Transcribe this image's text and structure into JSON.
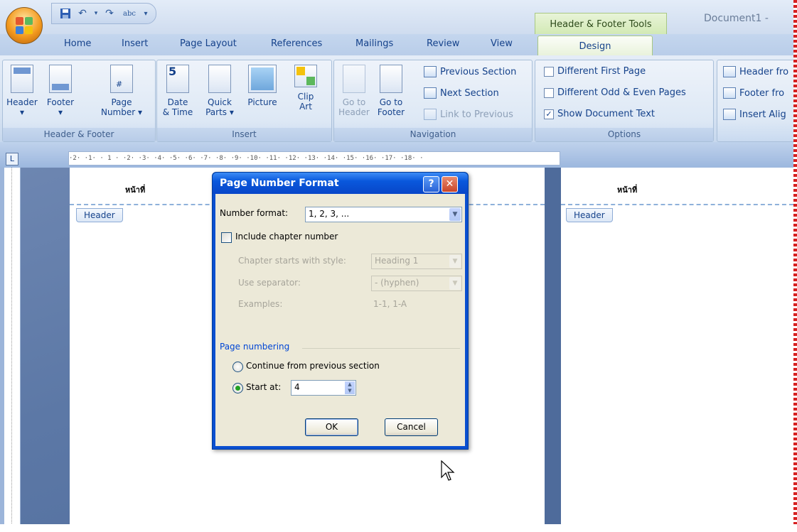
{
  "window": {
    "contextual_tab_group": "Header & Footer Tools",
    "document_title": "Document1 -"
  },
  "qat": {
    "undo_icon": "undo-icon",
    "save_icon": "save-icon",
    "spelling_label": "abc"
  },
  "tabs": [
    "Home",
    "Insert",
    "Page Layout",
    "References",
    "Mailings",
    "Review",
    "View",
    "Design"
  ],
  "ribbon": {
    "header_footer_group": {
      "label": "Header & Footer",
      "buttons": [
        {
          "line1": "Header",
          "line2": "▾"
        },
        {
          "line1": "Footer",
          "line2": "▾"
        },
        {
          "line1": "Page",
          "line2": "Number ▾"
        }
      ]
    },
    "insert_group": {
      "label": "Insert",
      "buttons": [
        {
          "line1": "Date",
          "line2": "& Time"
        },
        {
          "line1": "Quick",
          "line2": "Parts ▾"
        },
        {
          "line1": "Picture",
          "line2": ""
        },
        {
          "line1": "Clip",
          "line2": "Art"
        }
      ]
    },
    "navigation_group": {
      "label": "Navigation",
      "goto_header": {
        "line1": "Go to",
        "line2": "Header"
      },
      "goto_footer": {
        "line1": "Go to",
        "line2": "Footer"
      },
      "previous_section": "Previous Section",
      "next_section": "Next Section",
      "link_to_previous": "Link to Previous"
    },
    "options_group": {
      "label": "Options",
      "different_first_page": "Different First Page",
      "different_odd_even": "Different Odd & Even Pages",
      "show_document_text": "Show Document Text"
    },
    "position_group": {
      "header_from": "Header fro",
      "footer_from": "Footer fro",
      "insert_align": "Insert Alig"
    }
  },
  "ruler": {
    "marks": "·2· ·1· · 1 · ·2· ·3· ·4· ·5· ·6· ·7· ·8· ·9· ·10· ·11· ·12· ·13· ·14· ·15· ·16· ·17· ·18· ·"
  },
  "document": {
    "header_text_left": "หน้าที่",
    "header_text_right": "หน้าที่",
    "header_tab_left": "Header",
    "header_tab_right": "Header"
  },
  "dialog": {
    "title": "Page Number Format",
    "help_button": "?",
    "close_button": "✕",
    "number_format_label": "Number format:",
    "number_format_value": "1, 2, 3, ...",
    "include_chapter_label": "Include chapter number",
    "chapter_starts_label": "Chapter starts with style:",
    "chapter_starts_value": "Heading 1",
    "use_separator_label": "Use separator:",
    "use_separator_value": "-   (hyphen)",
    "examples_label": "Examples:",
    "examples_value": "1-1, 1-A",
    "page_numbering_label": "Page numbering",
    "continue_label": "Continue from previous section",
    "start_at_label": "Start at:",
    "start_at_value": "4",
    "ok_label": "OK",
    "cancel_label": "Cancel",
    "include_chapter_checked": false,
    "continue_selected": false,
    "start_at_selected": true
  },
  "options_state": {
    "different_first_page": false,
    "different_odd_even": false,
    "show_document_text": true
  }
}
